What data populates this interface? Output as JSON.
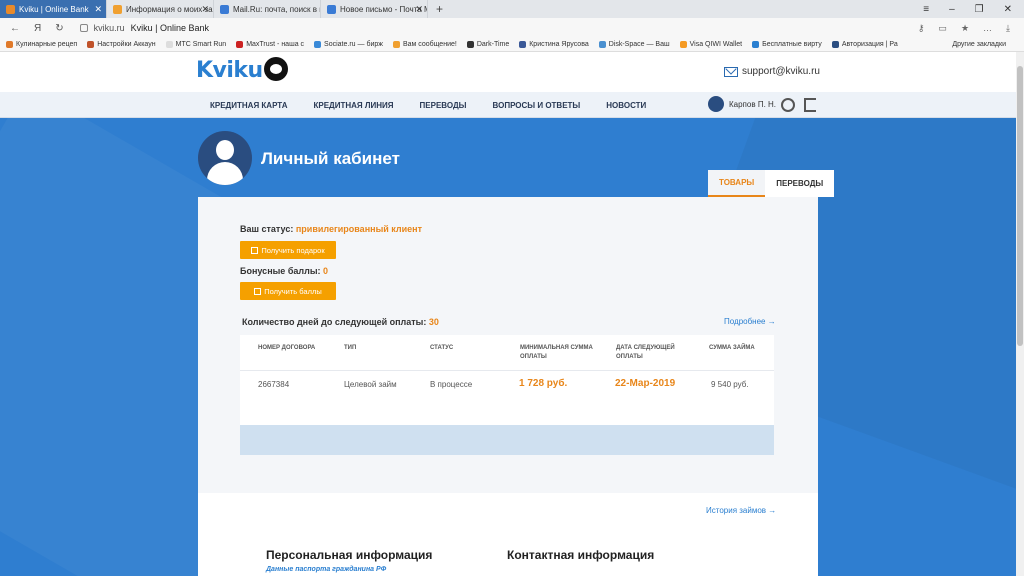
{
  "browser": {
    "tabs": [
      {
        "label": "Kviku | Online Bank",
        "active": true
      },
      {
        "label": "Информация о моих заказ",
        "active": false
      },
      {
        "label": "Mail.Ru: почта, поиск в ин",
        "active": false
      },
      {
        "label": "Новое письмо - Почта Ma",
        "active": false
      }
    ],
    "new_tab": "+",
    "address": {
      "domain": "kviku.ru",
      "title": "Kviku | Online Bank"
    },
    "bookmarks": [
      "Кулинарные рецеп",
      "Настройки Аккаун",
      "MTC Smart Run",
      "MaxTrust - наша с",
      "Sociate.ru — бирж",
      "Вам сообщение!",
      "Dark-Time",
      "Кристина Ярусова",
      "Disk-Space — Ваш",
      "Visa QIWI Wallet",
      "Бесплатные вирту",
      "Авторизация | Ра"
    ],
    "other_bookmarks": "Другие закладки"
  },
  "header": {
    "logo": "Kviku",
    "support_email": "support@kviku.ru"
  },
  "menu": {
    "items": [
      "КРЕДИТНАЯ КАРТА",
      "КРЕДИТНАЯ ЛИНИЯ",
      "ПЕРЕВОДЫ",
      "ВОПРОСЫ И ОТВЕТЫ",
      "НОВОСТИ"
    ],
    "user_name": "Карпов П. Н."
  },
  "cabinet": {
    "title": "Личный кабинет",
    "tabs": [
      "ТОВАРЫ",
      "ПЕРЕВОДЫ"
    ],
    "status_label": "Ваш статус:",
    "status_value": "привилегированный клиент",
    "gift_button": "Получить подарок",
    "bonus_label": "Бонусные баллы:",
    "bonus_value": "0",
    "points_button": "Получить баллы",
    "days_label": "Количество дней до следующей оплаты:",
    "days_value": "30",
    "more_link": "Подробнее →"
  },
  "loan_table": {
    "headers": [
      "НОМЕР ДОГОВОРА",
      "ТИП",
      "СТАТУС",
      "МИНИМАЛЬНАЯ СУММА ОПЛАТЫ",
      "ДАТА СЛЕДУЮЩЕЙ ОПЛАТЫ",
      "СУММА ЗАЙМА"
    ],
    "row": [
      "2667384",
      "Целевой займ",
      "В процессе",
      "1 728 руб.",
      "22-Мар-2019",
      "9 540 руб."
    ]
  },
  "lower": {
    "history_link": "История займов →",
    "personal_title": "Персональная информация",
    "passport_link": "Данные паспорта гражданина РФ",
    "contact_title": "Контактная информация"
  },
  "colors": {
    "brand_blue": "#2f7ed0",
    "accent_orange": "#f5a000",
    "dark_navy": "#2a4d80"
  }
}
